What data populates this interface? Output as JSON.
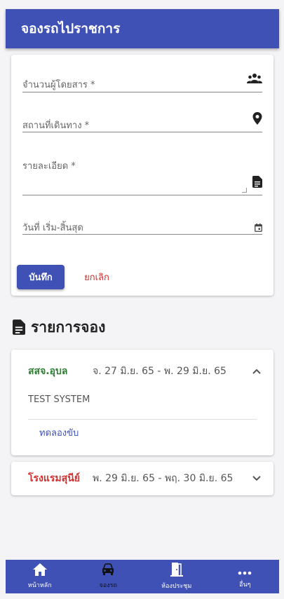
{
  "header": {
    "title": "จองรถไปราชการ"
  },
  "form": {
    "fields": [
      {
        "label": "จำนวนผู้โดยสาร *",
        "icon": "people-icon"
      },
      {
        "label": "สถานที่เดินทาง *",
        "icon": "location-pin-icon"
      },
      {
        "label": "รายละเอียด *",
        "icon": "document-icon"
      },
      {
        "label": "วันที่ เริ่ม-สิ้นสุด",
        "icon": "calendar-icon"
      }
    ],
    "save_label": "บันทึก",
    "cancel_label": "ยกเลิก"
  },
  "bookings": {
    "title": "รายการจอง",
    "items": [
      {
        "place": "สสจ.อุบล",
        "place_color": "#2e7d32",
        "dates": "จ. 27 มิ.ย. 65 - พ. 29 มิ.ย. 65",
        "expanded": true,
        "detail": "TEST SYSTEM",
        "action": "ทดลองขับ"
      },
      {
        "place": "โรงแรมสุนีย์",
        "place_color": "#d32f2f",
        "dates": "พ. 29 มิ.ย. 65 - พฤ. 30 มิ.ย. 65",
        "expanded": false
      }
    ]
  },
  "nav": {
    "items": [
      {
        "label": "หน้าหลัก",
        "icon": "home-icon"
      },
      {
        "label": "จองรถ",
        "icon": "car-icon",
        "active": true
      },
      {
        "label": "ห้องประชุม",
        "icon": "door-icon"
      },
      {
        "label": "อื่นๆ",
        "icon": "more-icon"
      }
    ]
  },
  "colors": {
    "primary": "#3f51b5",
    "danger": "#d32f2f",
    "success": "#2e7d32"
  }
}
